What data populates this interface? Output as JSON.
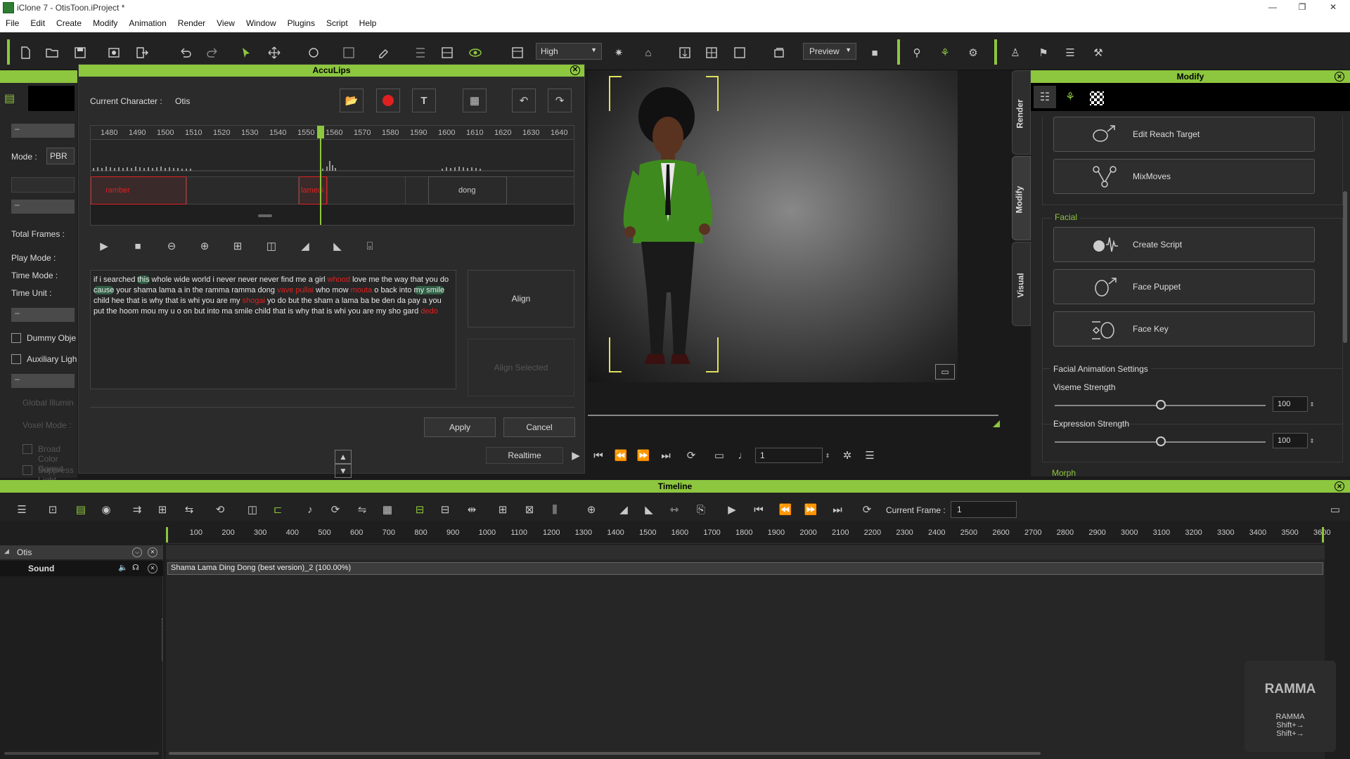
{
  "window": {
    "title": "iClone 7 - OtisToon.iProject *"
  },
  "menu": [
    "File",
    "Edit",
    "Create",
    "Modify",
    "Animation",
    "Render",
    "View",
    "Window",
    "Plugins",
    "Script",
    "Help"
  ],
  "toolbar": {
    "quality": "High",
    "preview": "Preview"
  },
  "left_panel": {
    "mode_label": "Mode :",
    "mode_value": "PBR",
    "total_frames": "Total Frames :",
    "play_mode": "Play Mode :",
    "time_mode": "Time Mode :",
    "time_unit": "Time Unit :",
    "dummy": "Dummy Obje",
    "aux": "Auxiliary Ligh",
    "global": "Global Illumin",
    "voxel": "Voxel Mode :",
    "broad": "Broad Color Gamut",
    "suppress": "Suppress Light Flicker",
    "dash": "–"
  },
  "acculips": {
    "title": "AccuLips",
    "current_character_label": "Current Character :",
    "current_character": "Otis",
    "ruler": [
      "1480",
      "1490",
      "1500",
      "1510",
      "1520",
      "1530",
      "1540",
      "1550",
      "1560",
      "1570",
      "1580",
      "1590",
      "1600",
      "1610",
      "1620",
      "1630",
      "1640"
    ],
    "words": [
      "ramber",
      "lamedi",
      "dong"
    ],
    "text_parts": [
      {
        "t": "if i searched ",
        "c": "n"
      },
      {
        "t": "this",
        "c": "h"
      },
      {
        "t": " whole wide world i never never never find me a girl ",
        "c": "n"
      },
      {
        "t": "whood",
        "c": "r"
      },
      {
        "t": " love me the way that you do ",
        "c": "n"
      },
      {
        "t": "cause",
        "c": "h"
      },
      {
        "t": " your shama lama a in the ramma ramma dong ",
        "c": "n"
      },
      {
        "t": "vave pullai",
        "c": "r"
      },
      {
        "t": " who mow ",
        "c": "n"
      },
      {
        "t": "mouta",
        "c": "r"
      },
      {
        "t": " o back into ",
        "c": "n"
      },
      {
        "t": "my smile",
        "c": "h"
      },
      {
        "t": " child hee that is why that is whi you are my ",
        "c": "n"
      },
      {
        "t": "shogai",
        "c": "r"
      },
      {
        "t": " yo do but the sham a lama ba be den da pay a you put the hoom mou my u o on but into ma smile child that is why that is whi you are my sho gard ",
        "c": "n"
      },
      {
        "t": "dedo",
        "c": "r"
      }
    ],
    "align": "Align",
    "align_selected": "Align Selected",
    "apply": "Apply",
    "cancel": "Cancel"
  },
  "playback": {
    "realtime": "Realtime",
    "frame": "1"
  },
  "modify": {
    "title": "Modify",
    "buttons": [
      "Edit Reach Target",
      "MixMoves"
    ],
    "facial_label": "Facial",
    "facial_buttons": [
      "Create Script",
      "Face Puppet",
      "Face Key"
    ],
    "settings_label": "Facial Animation Settings",
    "viseme_label": "Viseme Strength",
    "viseme_value": "100",
    "viseme_level": 0.5,
    "expression_label": "Expression Strength",
    "expression_value": "100",
    "expression_level": 0.5,
    "morph_label": "Morph"
  },
  "side_tabs": [
    "Render",
    "Modify",
    "Visual"
  ],
  "timeline": {
    "title": "Timeline",
    "current_frame_label": "Current Frame :",
    "current_frame": "1",
    "ticks": [
      "100",
      "200",
      "300",
      "400",
      "500",
      "600",
      "700",
      "800",
      "900",
      "1000",
      "1100",
      "1200",
      "1300",
      "1400",
      "1500",
      "1600",
      "1700",
      "1800",
      "1900",
      "2000",
      "2100",
      "2200",
      "2300",
      "2400",
      "2500",
      "2600",
      "2700",
      "2800",
      "2900",
      "3000",
      "3100",
      "3200",
      "3300",
      "3400",
      "3500",
      "3600"
    ],
    "track_otis": "Otis",
    "track_sound": "Sound",
    "clip": "Shama Lama Ding Dong (best version)_2 (100.00%)"
  },
  "hint": {
    "big": "RAMMA",
    "small": "RAMMA",
    "k1": "Shift+→",
    "k2": "Shift+→"
  },
  "colors": {
    "accent": "#8dc63f",
    "highlight_red": "#e02020"
  }
}
